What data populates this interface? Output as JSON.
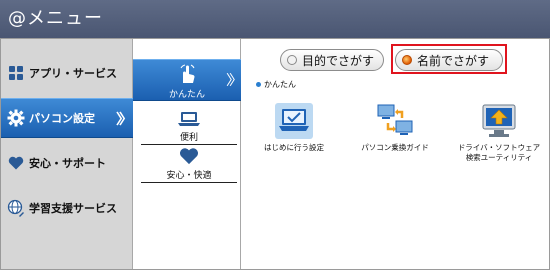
{
  "window": {
    "title": "@メニュー"
  },
  "categories": [
    {
      "label": "アプリ・サービス",
      "icon": "apps-grid-icon"
    },
    {
      "label": "パソコン設定",
      "icon": "gear-icon",
      "active": true
    },
    {
      "label": "安心・サポート",
      "icon": "heart-icon"
    },
    {
      "label": "学習支援サービス",
      "icon": "globe-icon"
    }
  ],
  "subcategories": [
    {
      "label": "かんたん",
      "icon": "pointing-hand-icon",
      "active": true
    },
    {
      "label": "便利",
      "icon": "laptop-icon"
    },
    {
      "label": "安心・快適",
      "icon": "heart-icon"
    }
  ],
  "search": {
    "by_purpose_label": "目的でさがす",
    "by_name_label": "名前でさがす",
    "selected": "名前でさがす"
  },
  "section": {
    "label": "かんたん"
  },
  "apps": [
    {
      "label": "はじめに行う設定",
      "icon": "laptop-check-icon"
    },
    {
      "label": "パソコン乗換ガイド",
      "icon": "pc-transfer-icon"
    },
    {
      "label": "ドライバ・ソフトウェア\n検索ユーティリティ",
      "line1": "ドライバ・ソフトウェア",
      "line2": "検索ユーティリティ",
      "icon": "monitor-upload-icon"
    }
  ],
  "colors": {
    "titlebar": "#525e7a",
    "active_blue": "#2a72c4",
    "highlight_red": "#e0141e"
  }
}
